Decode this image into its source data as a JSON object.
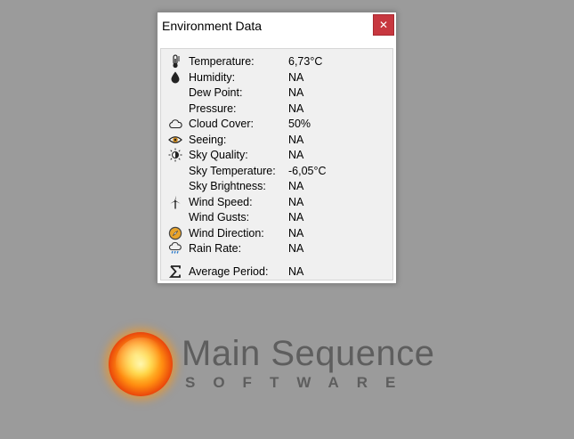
{
  "window": {
    "title": "Environment Data",
    "close_label": "✕"
  },
  "rows": [
    {
      "label": "Temperature:",
      "value": "6,73°C",
      "icon": "thermometer-icon"
    },
    {
      "label": "Humidity:",
      "value": "NA",
      "icon": "droplet-icon"
    },
    {
      "label": "Dew Point:",
      "value": "NA",
      "icon": ""
    },
    {
      "label": "Pressure:",
      "value": "NA",
      "icon": ""
    },
    {
      "label": "Cloud Cover:",
      "value": "50%",
      "icon": "cloud-icon"
    },
    {
      "label": "Seeing:",
      "value": "NA",
      "icon": "eye-icon"
    },
    {
      "label": "Sky Quality:",
      "value": "NA",
      "icon": "half-sun-icon"
    },
    {
      "label": "Sky Temperature:",
      "value": "-6,05°C",
      "icon": ""
    },
    {
      "label": "Sky Brightness:",
      "value": "NA",
      "icon": ""
    },
    {
      "label": "Wind Speed:",
      "value": "NA",
      "icon": "wind-turbine-icon"
    },
    {
      "label": "Wind Gusts:",
      "value": "NA",
      "icon": ""
    },
    {
      "label": "Wind Direction:",
      "value": "NA",
      "icon": "compass-icon"
    },
    {
      "label": "Rain Rate:",
      "value": "NA",
      "icon": "rain-cloud-icon"
    },
    {
      "label": "Average Period:",
      "value": "NA",
      "icon": "sigma-icon"
    }
  ],
  "brand": {
    "main": "Main Sequence",
    "sub": "SOFTWARE"
  },
  "colors": {
    "desktop": "#9b9b9b",
    "close_button": "#c7373f",
    "client_bg": "#f0f0f0",
    "brand_text": "#5e5e5e"
  }
}
